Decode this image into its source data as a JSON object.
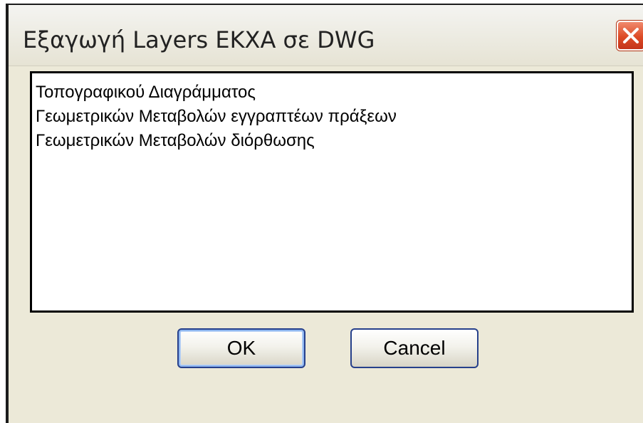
{
  "dialog": {
    "title": "Εξαγωγή Layers ΕΚΧΑ σε DWG",
    "close_icon": "close-x-icon"
  },
  "list": {
    "items": [
      "Τοπογραφικού Διαγράμματος",
      "Γεωμετρικών Μεταβολών εγγραπτέων πράξεων",
      "Γεωμετρικών Μεταβολών διόρθωσης"
    ]
  },
  "buttons": {
    "ok_label": "OK",
    "cancel_label": "Cancel"
  },
  "colors": {
    "dialog_background": "#ece9d8",
    "close_button": "#dd4a25",
    "button_border": "#26408b"
  }
}
